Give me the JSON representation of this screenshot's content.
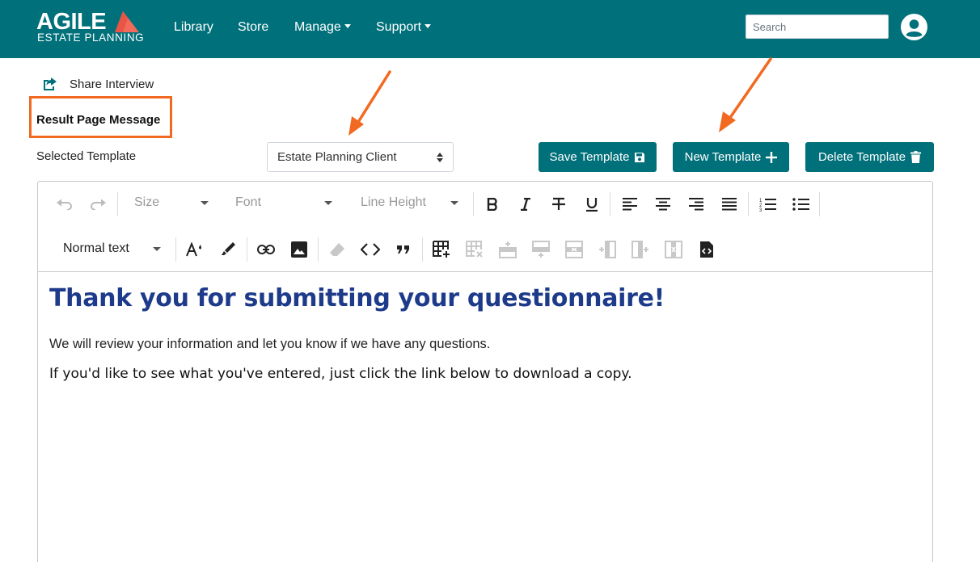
{
  "brand": {
    "name": "AGILE",
    "tagline": "ESTATE PLANNING",
    "accent": "#f26a5a"
  },
  "nav": {
    "items": [
      {
        "label": "Library"
      },
      {
        "label": "Store"
      },
      {
        "label": "Manage"
      },
      {
        "label": "Support"
      }
    ],
    "search": {
      "placeholder": "Search",
      "value": ""
    },
    "avatar_icon": "user-circle-icon"
  },
  "page": {
    "share_label": "Share Interview",
    "section_title": "Result Page Message",
    "selected_template_label": "Selected Template",
    "selected_template_value": "Estate Planning Client",
    "buttons": {
      "save": "Save Template",
      "new": "New Template",
      "delete": "Delete Template"
    }
  },
  "editor": {
    "toolbar": {
      "size_label": "Size",
      "font_label": "Font",
      "line_height_label": "Line Height",
      "paragraph_style": "Normal text"
    },
    "content": {
      "heading": "Thank you for submitting your questionnaire!",
      "paragraph1": "We will review your information and let you know if we have any questions.",
      "paragraph2": "If you'd like to see what you've entered, just click the link below to download a copy."
    }
  },
  "colors": {
    "primary": "#00707a",
    "highlight_box": "#f26a21",
    "heading_text": "#1d3b8a"
  }
}
